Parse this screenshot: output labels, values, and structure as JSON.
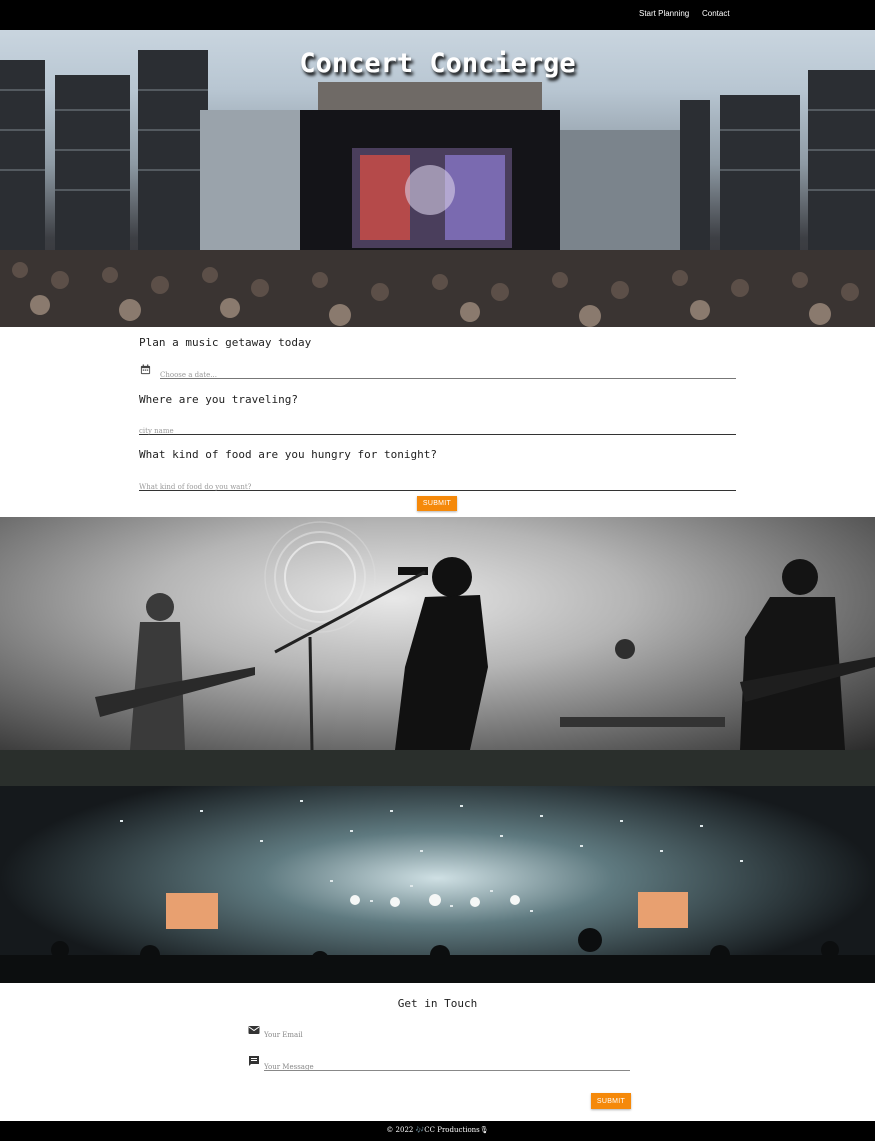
{
  "nav": {
    "links": [
      "Start Planning",
      "Contact"
    ]
  },
  "hero": {
    "title": "Concert Concierge",
    "image": "festival-stage-crowd"
  },
  "planner": {
    "date_question": "Plan a music getaway today",
    "date_placeholder": "Choose a date...",
    "city_question": "Where are you traveling?",
    "city_placeholder": "city name",
    "food_question": "What kind of food are you hungry for tonight?",
    "food_placeholder": "What kind of food do you want?",
    "submit_label": "SUBMIT"
  },
  "gallery": {
    "images": [
      "singer-live-black-white",
      "confetti-concert-crowd"
    ]
  },
  "contact": {
    "title": "Get in Touch",
    "email_placeholder": "Your Email",
    "message_placeholder": "Your Message",
    "submit_label": "SUBMIT"
  },
  "footer": {
    "text": "© 2022 🎶CC Productions🎙"
  },
  "colors": {
    "accent": "#f5890a",
    "nav_bg": "#000000",
    "footer_bg": "#000000"
  },
  "icons": [
    "calendar-icon",
    "mail-icon",
    "message-icon"
  ]
}
